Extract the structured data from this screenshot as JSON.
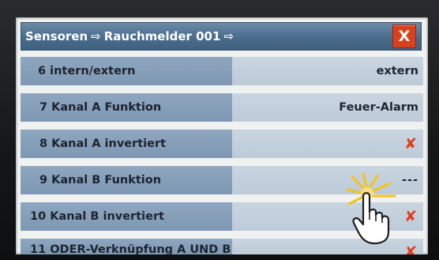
{
  "header": {
    "crumbs": [
      "Sensoren",
      "Rauchmelder 001"
    ],
    "separator": "⇨",
    "close_label": "X"
  },
  "rows": [
    {
      "label": "6 intern/extern",
      "value": "extern",
      "kind": "text"
    },
    {
      "label": "7 Kanal A Funktion",
      "value": "Feuer-Alarm",
      "kind": "text"
    },
    {
      "label": "8 Kanal A invertiert",
      "value": "✘",
      "kind": "cross"
    },
    {
      "label": "9 Kanal B Funktion",
      "value": "---",
      "kind": "text"
    },
    {
      "label": "10 Kanal B invertiert",
      "value": "✘",
      "kind": "cross"
    },
    {
      "label": "11 ODER-Verknüpfung A UND B",
      "value": "✘",
      "kind": "cross"
    }
  ],
  "colors": {
    "title_bar": "#4a6c8c",
    "label_cell": "#8ea6bf",
    "value_cell": "#c9d5e0",
    "close_button": "#d8411e",
    "cross": "#e0401c"
  },
  "icons": {
    "pointer": "touch-hand-icon",
    "separator": "arrow-right-icon",
    "close": "close-icon",
    "unchecked": "cross-icon"
  }
}
